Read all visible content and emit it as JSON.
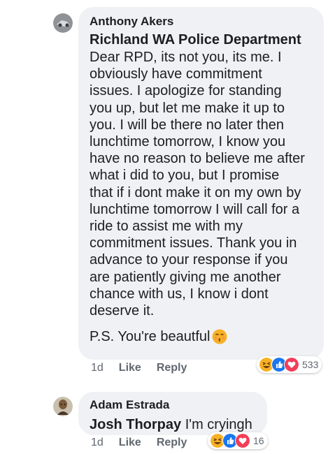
{
  "comments": [
    {
      "author": "Anthony Akers",
      "tag": "Richland WA Police Department",
      "body": "Dear RPD, its not you, its me. I\nobviously have commitment\nissues. I apologize for standing\nyou up, but let me make it up to\nyou. I will be there no later then\nlunchtime tomorrow, I know you\nhave no reason to believe me after\nwhat i did to you, but I promise\nthat if i dont make it on my own by\nlunchtime tomorrow I will call for a\nride to assist me with my\ncommitment issues. Thank you in\nadvance to your response if you\nare patiently giving me another\nchance with us, I know i dont\ndeserve it.",
      "ps": "P.S. You're beautful",
      "time": "1d",
      "like_label": "Like",
      "reply_label": "Reply",
      "reaction_count": "533",
      "reaction_icons": [
        "haha-icon",
        "like-icon",
        "love-icon"
      ]
    },
    {
      "author": "Adam Estrada",
      "tag": "Josh Thorpay",
      "body": "I'm cryingh",
      "time": "1d",
      "like_label": "Like",
      "reply_label": "Reply",
      "reaction_count": "16",
      "reaction_icons": [
        "haha-icon",
        "like-icon",
        "love-icon"
      ]
    }
  ],
  "colors": {
    "bubble": "#f0f1f4",
    "like_blue": "#1877f2",
    "love_red": "#f33e58",
    "haha_yellow": "#f7b125",
    "meta_gray": "#606770"
  }
}
